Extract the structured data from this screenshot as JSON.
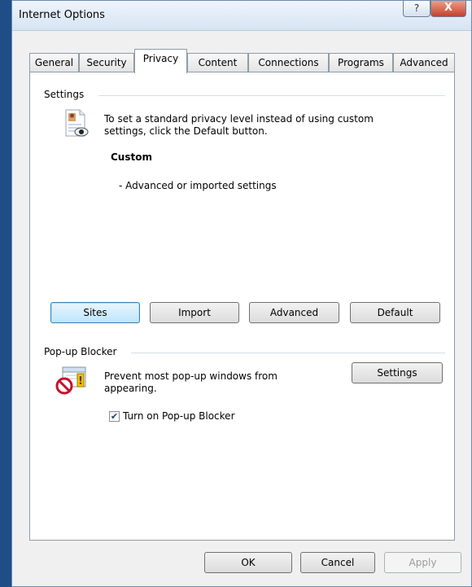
{
  "window": {
    "title": "Internet Options",
    "help_label": "?",
    "close_label": "X"
  },
  "tabs": [
    {
      "label": "General"
    },
    {
      "label": "Security"
    },
    {
      "label": "Privacy"
    },
    {
      "label": "Content"
    },
    {
      "label": "Connections"
    },
    {
      "label": "Programs"
    },
    {
      "label": "Advanced"
    }
  ],
  "settings": {
    "title": "Settings",
    "icon": "privacy-eye-icon",
    "description": [
      "To set a standard privacy level instead of using custom",
      "settings, click the Default button."
    ],
    "level": "Custom",
    "level_detail": "- Advanced or imported settings",
    "buttons": {
      "sites": "Sites",
      "import": "Import",
      "advanced": "Advanced",
      "default": "Default"
    }
  },
  "popup": {
    "title": "Pop-up Blocker",
    "icon": "popup-blocker-icon",
    "description": [
      "Prevent most pop-up windows from",
      "appearing."
    ],
    "settings_button": "Settings",
    "checkbox_label": "Turn on Pop-up Blocker",
    "checkbox_checked": true
  },
  "footer": {
    "ok": "OK",
    "cancel": "Cancel",
    "apply": "Apply"
  }
}
